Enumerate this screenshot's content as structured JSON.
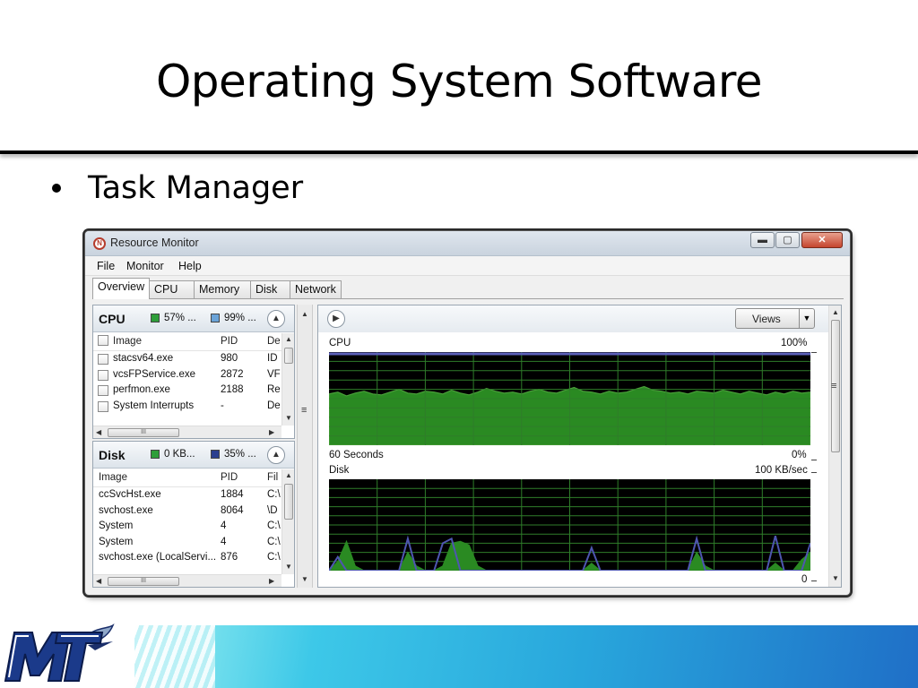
{
  "slide": {
    "title": "Operating System Software",
    "bullet": "Task Manager"
  },
  "window": {
    "title": "Resource Monitor",
    "controls": {
      "minimize": "▬",
      "maximize": "▢",
      "close": "✕"
    },
    "menu": [
      "File",
      "Monitor",
      "Help"
    ],
    "tabs": [
      "Overview",
      "CPU",
      "Memory",
      "Disk",
      "Network"
    ],
    "active_tab": "Overview"
  },
  "cpu_section": {
    "name": "CPU",
    "stat1": "57% ...",
    "stat2": "99% ...",
    "stat1_color": "#2e9e3a",
    "stat2_color": "#6aa3d8",
    "columns": [
      "Image",
      "PID",
      "De"
    ],
    "rows": [
      {
        "image": "stacsv64.exe",
        "pid": "980",
        "desc": "ID"
      },
      {
        "image": "vcsFPService.exe",
        "pid": "2872",
        "desc": "VF"
      },
      {
        "image": "perfmon.exe",
        "pid": "2188",
        "desc": "Re"
      },
      {
        "image": "System Interrupts",
        "pid": "-",
        "desc": "De"
      }
    ]
  },
  "disk_section": {
    "name": "Disk",
    "stat1": "0 KB...",
    "stat2": "35% ...",
    "stat1_color": "#2e9e3a",
    "stat2_color": "#2b3f8f",
    "columns": [
      "Image",
      "PID",
      "Fil"
    ],
    "rows": [
      {
        "image": "ccSvcHst.exe",
        "pid": "1884",
        "file": "C:\\"
      },
      {
        "image": "svchost.exe",
        "pid": "8064",
        "file": "\\D"
      },
      {
        "image": "System",
        "pid": "4",
        "file": "C:\\"
      },
      {
        "image": "System",
        "pid": "4",
        "file": "C:\\"
      },
      {
        "image": "svchost.exe (LocalServi...",
        "pid": "876",
        "file": "C:\\"
      }
    ]
  },
  "scroll": {
    "thumb_label": "III",
    "up": "▲",
    "down": "▼",
    "left": "◀",
    "right": "▶",
    "grip": "≡"
  },
  "graphs": {
    "views_label": "Views",
    "cpu": {
      "label": "CPU",
      "max": "100%",
      "time": "60 Seconds",
      "min": "0%",
      "fill_color": "#2a8a22",
      "line_color": "#4a9f3a",
      "max_line_color": "#5b5fb8",
      "values": [
        55,
        57,
        53,
        56,
        58,
        55,
        54,
        57,
        60,
        56,
        55,
        58,
        57,
        55,
        59,
        56,
        54,
        57,
        61,
        58,
        56,
        57,
        55,
        58,
        60,
        57,
        56,
        59,
        62,
        58,
        57,
        55,
        58,
        56,
        57,
        60,
        63,
        59,
        58,
        56,
        57,
        55,
        58,
        57,
        56,
        59,
        57,
        55,
        58,
        56,
        54,
        57,
        55,
        58,
        56,
        57
      ]
    },
    "disk": {
      "label": "Disk",
      "max": "100 KB/sec",
      "min": "0",
      "fill_color": "#2a8a22",
      "line_color": "#4e56b0",
      "fill_values": [
        0,
        10,
        32,
        5,
        0,
        0,
        0,
        0,
        0,
        20,
        5,
        0,
        0,
        5,
        30,
        32,
        28,
        5,
        0,
        0,
        0,
        0,
        0,
        0,
        0,
        0,
        0,
        0,
        0,
        0,
        8,
        0,
        0,
        0,
        0,
        0,
        0,
        0,
        0,
        0,
        0,
        0,
        20,
        5,
        0,
        0,
        0,
        0,
        0,
        0,
        0,
        8,
        0,
        0,
        12,
        20
      ],
      "line_values": [
        0,
        15,
        0,
        0,
        0,
        0,
        0,
        0,
        0,
        35,
        0,
        0,
        0,
        30,
        35,
        0,
        0,
        0,
        0,
        0,
        0,
        0,
        0,
        0,
        0,
        0,
        0,
        0,
        0,
        0,
        25,
        0,
        0,
        0,
        0,
        0,
        0,
        0,
        0,
        0,
        0,
        0,
        35,
        0,
        0,
        0,
        0,
        0,
        0,
        0,
        0,
        38,
        0,
        0,
        0,
        30
      ]
    }
  }
}
